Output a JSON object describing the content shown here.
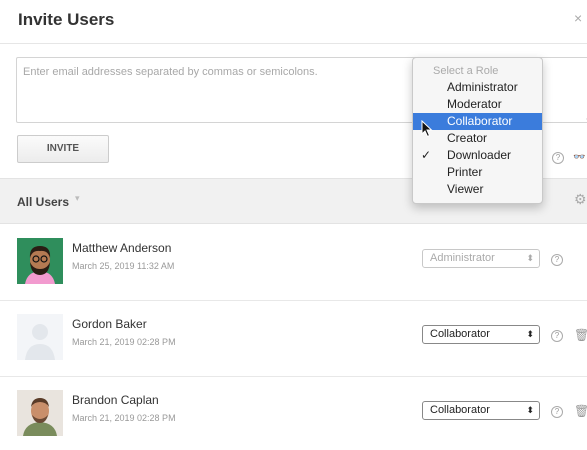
{
  "dialog": {
    "title": "Invite Users",
    "close_glyph": "×"
  },
  "email_input": {
    "placeholder": "Enter email addresses separated by commas or semicolons."
  },
  "invite_button": {
    "label": "INVITE"
  },
  "filter": {
    "label": "All Users",
    "caret": "▾",
    "gear": "⚙"
  },
  "role_menu": {
    "header": "Select a Role",
    "items": [
      "Administrator",
      "Moderator",
      "Collaborator",
      "Creator",
      "Downloader",
      "Printer",
      "Viewer"
    ],
    "highlighted": "Collaborator",
    "checked": "Downloader",
    "check_glyph": "✓"
  },
  "users": [
    {
      "name": "Matthew Anderson",
      "date": "March 25, 2019 11:32 AM",
      "role": "Administrator"
    },
    {
      "name": "Gordon Baker",
      "date": "March 21, 2019 02:28 PM",
      "role": "Collaborator"
    },
    {
      "name": "Brandon Caplan",
      "date": "March 21, 2019 02:28 PM",
      "role": "Collaborator"
    }
  ],
  "icons": {
    "help": "?",
    "trash": "🗑",
    "glasses": "👓",
    "select_arrows": "⬍"
  },
  "colors": {
    "menu_highlight": "#3b7cdc",
    "filter_bar": "#f1f1f1"
  }
}
